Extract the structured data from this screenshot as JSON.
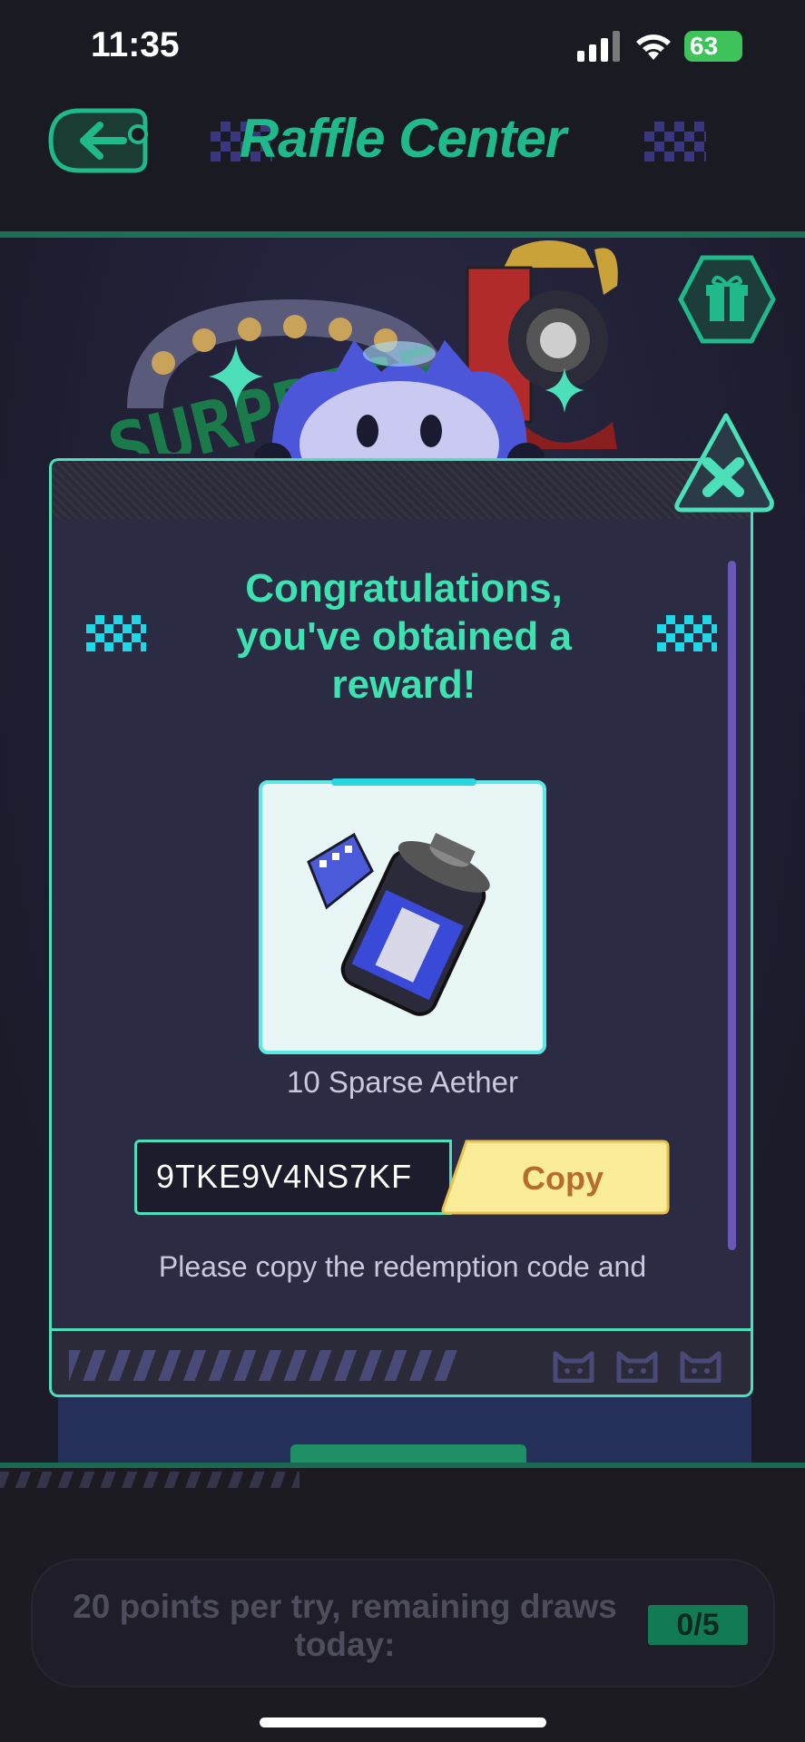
{
  "status_bar": {
    "time": "11:35",
    "battery": "63"
  },
  "header": {
    "title": "Raffle Center"
  },
  "dialog": {
    "congrats": "Congratulations, you've obtained a reward!",
    "reward_name": "10 Sparse Aether",
    "code": "9TKE9V4NS7KF",
    "copy_label": "Copy",
    "instruction": "Please copy the redemption code and"
  },
  "draws": {
    "text": "20 points per try, remaining draws today:",
    "count": "0/5"
  },
  "colors": {
    "accent": "#4be0b9",
    "title": "#1fb98a",
    "copy_button": "#fbec9a"
  }
}
